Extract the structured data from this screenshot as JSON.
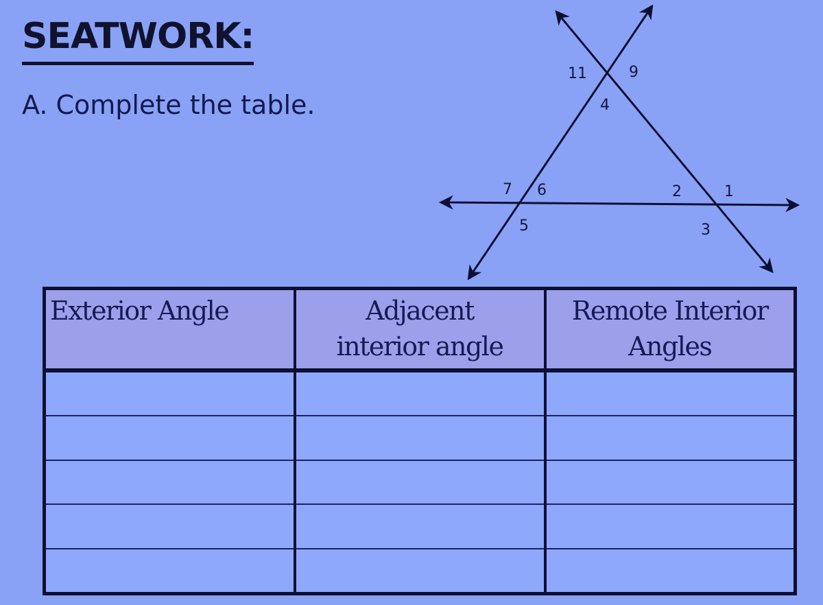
{
  "header": {
    "title": "SEATWORK:",
    "instruction": "A. Complete the table."
  },
  "diagram": {
    "angle_labels": [
      "11",
      "9",
      "4",
      "7",
      "6",
      "2",
      "1",
      "5",
      "3"
    ]
  },
  "table": {
    "columns": [
      {
        "line1": "Exterior Angle",
        "line2": ""
      },
      {
        "line1": "Adjacent",
        "line2": "interior angle"
      },
      {
        "line1": "Remote Interior",
        "line2": "Angles"
      }
    ],
    "rows": [
      [
        "",
        "",
        ""
      ],
      [
        "",
        "",
        ""
      ],
      [
        "",
        "",
        ""
      ],
      [
        "",
        "",
        ""
      ],
      [
        "",
        "",
        ""
      ]
    ]
  }
}
